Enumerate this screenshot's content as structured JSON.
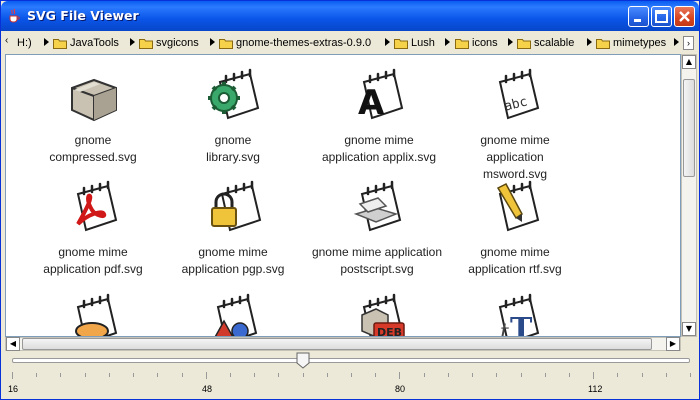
{
  "window": {
    "title": "SVG File Viewer"
  },
  "breadcrumb": {
    "items": [
      "H:)",
      "JavaTools",
      "svgicons",
      "gnome-themes-extras-0.9.0",
      "Lush",
      "icons",
      "scalable",
      "mimetypes"
    ]
  },
  "files": [
    {
      "line1": "gnome",
      "line2": "compressed.svg",
      "icon": "package-box-icon"
    },
    {
      "line1": "gnome",
      "line2": "library.svg",
      "icon": "gear-document-icon"
    },
    {
      "line1": "gnome mime",
      "line2": "application applix.svg",
      "icon": "letter-a-document-icon"
    },
    {
      "line1": "gnome mime",
      "line2": "application msword.svg",
      "icon": "abc-document-icon"
    },
    {
      "line1": "gnome mime",
      "line2": "application pdf.svg",
      "icon": "pdf-document-icon"
    },
    {
      "line1": "gnome mime",
      "line2": "application pgp.svg",
      "icon": "padlock-document-icon"
    },
    {
      "line1": "gnome mime application",
      "line2": "postscript.svg",
      "icon": "postscript-document-icon"
    },
    {
      "line1": "gnome mime",
      "line2": "application rtf.svg",
      "icon": "pencil-document-icon"
    },
    {
      "line1": "",
      "line2": "",
      "icon": "oval-document-icon"
    },
    {
      "line1": "",
      "line2": "",
      "icon": "shapes-document-icon"
    },
    {
      "line1": "",
      "line2": "",
      "icon": "deb-package-icon"
    },
    {
      "line1": "",
      "line2": "",
      "icon": "font-tt-document-icon"
    }
  ],
  "zoom_slider": {
    "min": 16,
    "max": 128,
    "value": 64,
    "labels": [
      "16",
      "48",
      "80",
      "112"
    ]
  },
  "colors": {
    "title_bar": "#0a55e8",
    "close_button": "#d6441f",
    "folder": "#f6d24b"
  }
}
